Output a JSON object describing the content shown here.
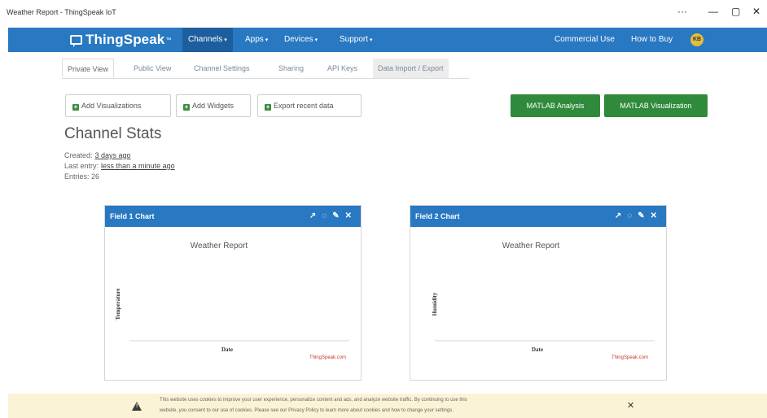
{
  "window": {
    "title": "Weather Report - ThingSpeak IoT",
    "controls": {
      "more": "···",
      "minimize": "—",
      "maximize": "▢",
      "close": "✕"
    }
  },
  "navbar": {
    "brand": "ThingSpeak",
    "brand_mark": "™",
    "menu": [
      {
        "label": "Channels",
        "active": true
      },
      {
        "label": "Apps"
      },
      {
        "label": "Devices"
      },
      {
        "label": "Support"
      }
    ],
    "commercial": "Commercial Use",
    "howtobuy": "How to Buy",
    "avatar": "KB"
  },
  "tabs": [
    "Private View",
    "Public View",
    "Channel Settings",
    "Sharing",
    "API Keys",
    "Data Import / Export"
  ],
  "buttons": {
    "add_vis": "Add Visualizations",
    "add_widgets": "Add Widgets",
    "export": "Export recent data",
    "matlab_analysis": "MATLAB Analysis",
    "matlab_vis": "MATLAB Visualization"
  },
  "stats": {
    "title": "Channel Stats",
    "created_label": "Created:",
    "created_value": "3 days ago",
    "last_entry_label": "Last entry:",
    "last_entry_value": "less than a minute ago",
    "entries_label": "Entries:",
    "entries_value": "26"
  },
  "chart_data": [
    {
      "type": "line",
      "card_title": "Field 1 Chart",
      "title": "Weather Report",
      "xlabel": "Date",
      "ylabel": "Temperature",
      "credit": "ThingSpeak.com",
      "series": []
    },
    {
      "type": "line",
      "card_title": "Field 2 Chart",
      "title": "Weather Report",
      "xlabel": "Date",
      "ylabel": "Humidity",
      "credit": "ThingSpeak.com",
      "series": []
    }
  ],
  "card_icons": {
    "external": "↗",
    "comment": "◌",
    "edit": "✎",
    "close": "✕"
  },
  "cookie": {
    "line1": "This website uses cookies to improve your user experience, personalize content and ads, and analyze website traffic. By continuing to use this",
    "line2": "website, you consent to our use of cookies. Please see our Privacy Policy to learn more about cookies and how to change your settings.",
    "close": "✕"
  }
}
